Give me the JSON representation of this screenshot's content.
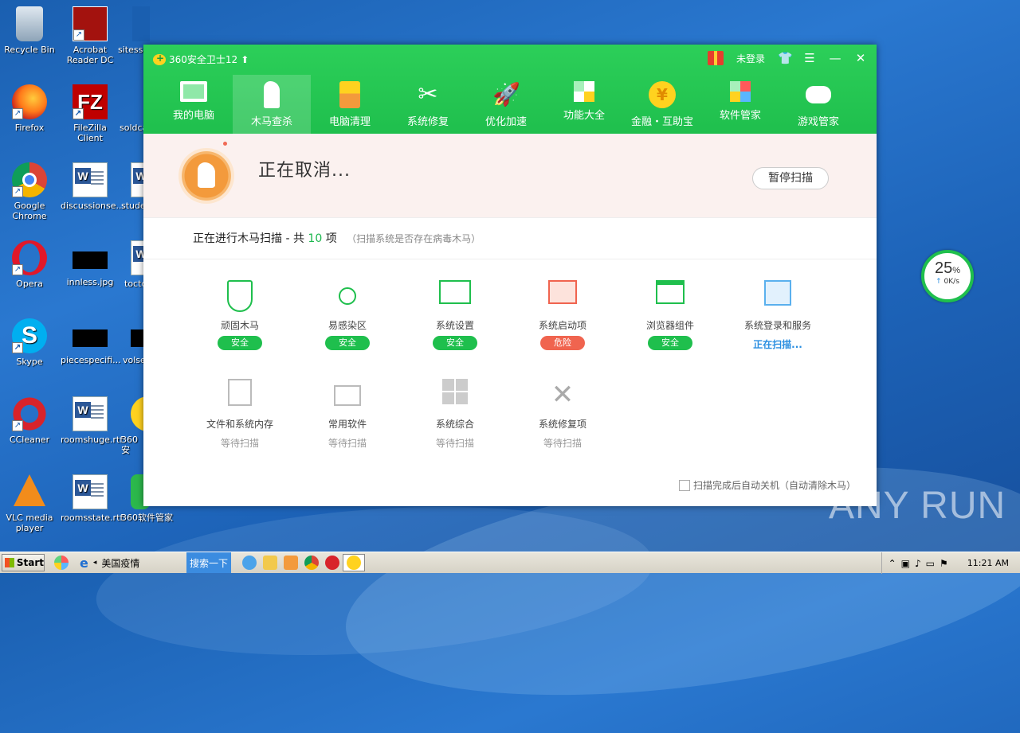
{
  "desktop": {
    "icons": [
      {
        "label": "Recycle Bin"
      },
      {
        "label": "Acrobat Reader DC"
      },
      {
        "label": "sitess"
      },
      {
        "label": "Firefox"
      },
      {
        "label": "FileZilla Client"
      },
      {
        "label": "soldca"
      },
      {
        "label": "Google Chrome"
      },
      {
        "label": "discussionse..."
      },
      {
        "label": "stude"
      },
      {
        "label": "Opera"
      },
      {
        "label": "innless.jpg"
      },
      {
        "label": "toctc"
      },
      {
        "label": "Skype"
      },
      {
        "label": "piecespecifi..."
      },
      {
        "label": "volse"
      },
      {
        "label": "CCleaner"
      },
      {
        "label": "roomshuge.rtf"
      },
      {
        "label": "360安"
      },
      {
        "label": "VLC media player"
      },
      {
        "label": "roomsstate.rtf"
      },
      {
        "label": "360软件管家"
      }
    ]
  },
  "app": {
    "title": "360安全卫士12",
    "login": "未登录",
    "tabs": [
      {
        "label": "我的电脑"
      },
      {
        "label": "木马查杀"
      },
      {
        "label": "电脑清理"
      },
      {
        "label": "系统修复"
      },
      {
        "label": "优化加速"
      },
      {
        "label": "功能大全"
      },
      {
        "label": "金融・互助宝"
      },
      {
        "label": "软件管家"
      },
      {
        "label": "游戏管家"
      }
    ],
    "status": "正在取消...",
    "pause_button": "暂停扫描",
    "scan_prefix": "正在进行木马扫描 - 共",
    "scan_count": "10",
    "scan_suffix": "项",
    "scan_note": "（扫描系统是否存在病毒木马）",
    "items": [
      {
        "label": "顽固木马",
        "state": "安全"
      },
      {
        "label": "易感染区",
        "state": "安全"
      },
      {
        "label": "系统设置",
        "state": "安全"
      },
      {
        "label": "系统启动项",
        "state": "危险"
      },
      {
        "label": "浏览器组件",
        "state": "安全"
      },
      {
        "label": "系统登录和服务",
        "state": "正在扫描..."
      },
      {
        "label": "文件和系统内存",
        "state": "等待扫描"
      },
      {
        "label": "常用软件",
        "state": "等待扫描"
      },
      {
        "label": "系统综合",
        "state": "等待扫描"
      },
      {
        "label": "系统修复项",
        "state": "等待扫描"
      }
    ],
    "footer_option": "扫描完成后自动关机（自动清除木马）"
  },
  "speed_widget": {
    "percent": "25",
    "unit": "%",
    "rate": "0K/s"
  },
  "watermark": "ANY RUN",
  "taskbar": {
    "start": "Start",
    "window_label": "美国疫情",
    "search_label": "搜索一下",
    "clock": "11:21 AM"
  },
  "colors": {
    "accent_green": "#1fbf4d",
    "danger": "#f0644f",
    "scanning_blue": "#2a8ee0"
  }
}
